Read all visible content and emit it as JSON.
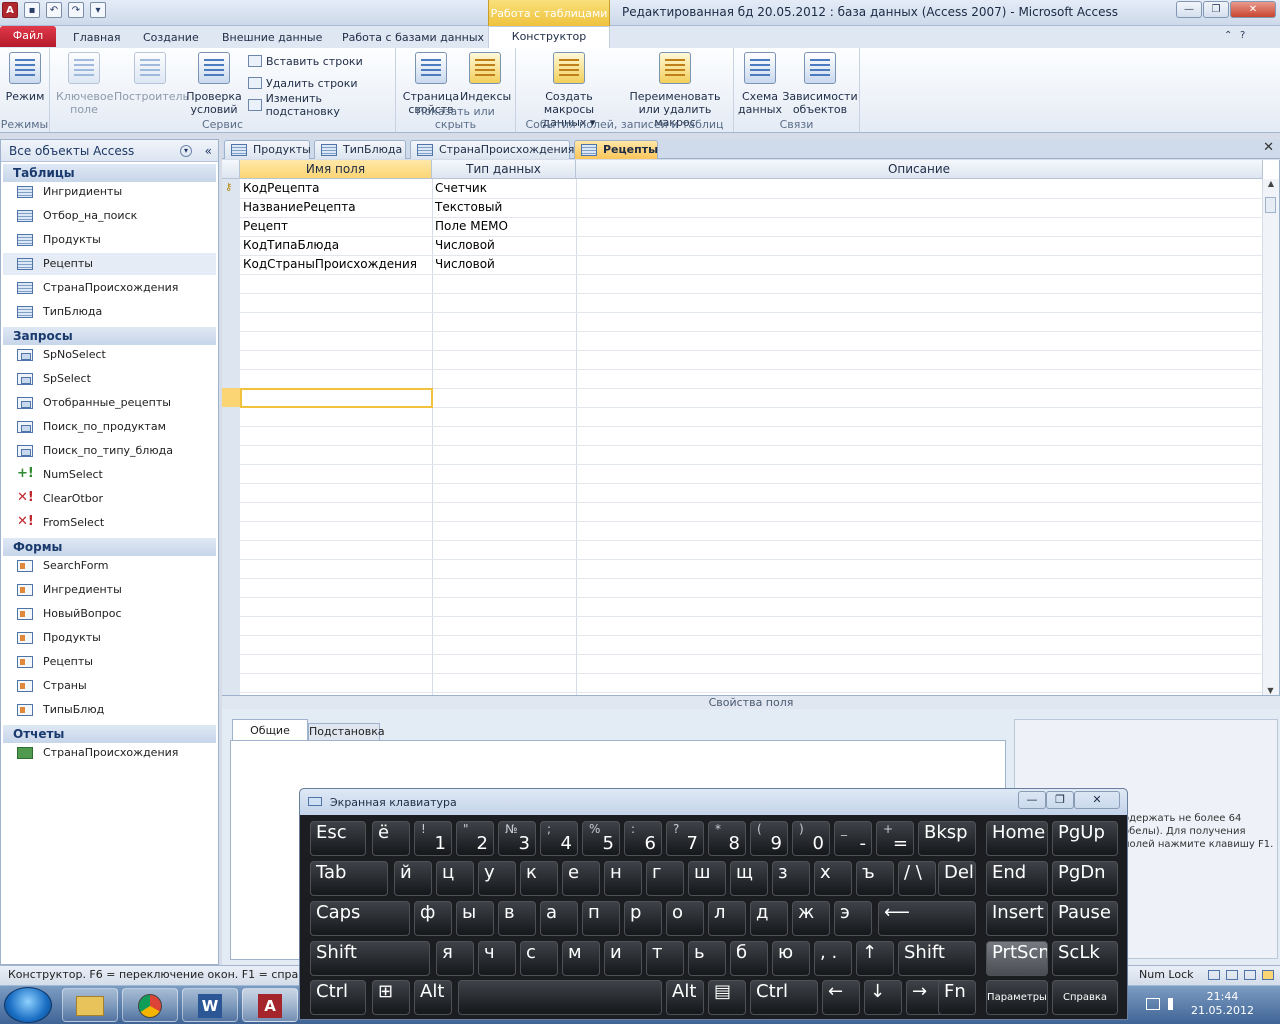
{
  "titlebar": {
    "context_header": "Работа с таблицами",
    "window_title": "Редактированная бд 20.05.2012 : база данных (Access 2007)  -  Microsoft Access"
  },
  "ribbon_tabs": [
    "Файл",
    "Главная",
    "Создание",
    "Внешние данные",
    "Работа с базами данных",
    "Конструктор"
  ],
  "ribbon": {
    "groups": {
      "modes": "Режимы",
      "service": "Сервис",
      "show_hide": "Показать или скрыть",
      "events": "События полей, записей и таблиц",
      "relations": "Связи"
    },
    "buttons": {
      "mode": "Режим",
      "key_field_1": "Ключевое",
      "key_field_2": "поле",
      "builder": "Построитель",
      "validate_1": "Проверка",
      "validate_2": "условий",
      "insert_rows": "Вставить строки",
      "delete_rows": "Удалить строки",
      "edit_lookup": "Изменить подстановку",
      "prop_sheet_1": "Страница",
      "prop_sheet_2": "свойств",
      "indexes": "Индексы",
      "create_macros_1": "Создать макросы",
      "create_macros_2": "данных ▾",
      "rename_macro_1": "Переименовать",
      "rename_macro_2": "или удалить макрос",
      "schema_1": "Схема",
      "schema_2": "данных",
      "deps_1": "Зависимости",
      "deps_2": "объектов"
    }
  },
  "nav": {
    "header": "Все объекты Access",
    "sections": [
      {
        "title": "Таблицы",
        "items": [
          "Ингридиенты",
          "Отбор_на_поиск",
          "Продукты",
          "Рецепты",
          "СтранаПроисхождения",
          "ТипБлюда"
        ]
      },
      {
        "title": "Запросы",
        "items": [
          "SpNoSelect",
          "SpSelect",
          "Отобранные_рецепты",
          "Поиск_по_продуктам",
          "Поиск_по_типу_блюда",
          "NumSelect",
          "ClearOtbor",
          "FromSelect"
        ]
      },
      {
        "title": "Формы",
        "items": [
          "SearchForm",
          "Ингредиенты",
          "НовыйВопрос",
          "Продукты",
          "Рецепты",
          "Страны",
          "ТипыБлюд"
        ]
      },
      {
        "title": "Отчеты",
        "items": [
          "СтранаПроисхождения"
        ]
      }
    ]
  },
  "doc_tabs": [
    "Продукты",
    "ТипБлюда",
    "СтранаПроисхождения",
    "Рецепты"
  ],
  "design_grid": {
    "headers": [
      "Имя поля",
      "Тип данных",
      "Описание"
    ],
    "rows": [
      {
        "name": "КодРецепта",
        "type": "Счетчик",
        "key": true
      },
      {
        "name": "НазваниеРецепта",
        "type": "Текстовый"
      },
      {
        "name": "Рецепт",
        "type": "Поле MEMO"
      },
      {
        "name": "КодТипаБлюда",
        "type": "Числовой"
      },
      {
        "name": "КодСтраныПроисхождения",
        "type": "Числовой"
      }
    ]
  },
  "field_props": {
    "bar": "Свойства поля",
    "tab_general": "Общие",
    "tab_lookup": "Подстановка",
    "help": "одержать не более 64 обелы). Для получения полей нажмите клавишу F1."
  },
  "status": {
    "left": "Конструктор.  F6 = переключение окон.  F1 = справка.",
    "numlock": "Num Lock"
  },
  "osk": {
    "title": "Экранная клавиатура",
    "row1": [
      [
        "Esc",
        ""
      ],
      [
        "",
        "ё"
      ],
      [
        "!",
        "1"
      ],
      [
        "\"",
        "2"
      ],
      [
        "№",
        "3"
      ],
      [
        ";",
        "4"
      ],
      [
        "%",
        "5"
      ],
      [
        ":",
        "6"
      ],
      [
        "?",
        "7"
      ],
      [
        "*",
        "8"
      ],
      [
        "(",
        "9"
      ],
      [
        ")",
        "0"
      ],
      [
        "_",
        "-"
      ],
      [
        "+",
        "="
      ],
      [
        "Bksp",
        ""
      ],
      [
        "Home",
        ""
      ],
      [
        "PgUp",
        ""
      ]
    ],
    "row2": [
      "Tab",
      "й",
      "ц",
      "у",
      "к",
      "е",
      "н",
      "г",
      "ш",
      "щ",
      "з",
      "х",
      "ъ",
      "/ \\",
      "Del",
      "End",
      "PgDn"
    ],
    "row3": [
      "Caps",
      "ф",
      "ы",
      "в",
      "а",
      "п",
      "р",
      "о",
      "л",
      "д",
      "ж",
      "э",
      "⟵",
      "Insert",
      "Pause"
    ],
    "row4": [
      "Shift",
      "я",
      "ч",
      "с",
      "м",
      "и",
      "т",
      "ь",
      "б",
      "ю",
      ",  .",
      "↑",
      "Shift",
      "PrtScn",
      "ScLk"
    ],
    "row5": [
      "Ctrl",
      "⊞",
      "Alt",
      "",
      "Alt",
      "▤",
      "Ctrl",
      "←",
      "↓",
      "→",
      "Fn",
      "Параметры",
      "Справка"
    ]
  },
  "taskbar": {
    "time": "21:44",
    "date": "21.05.2012"
  }
}
